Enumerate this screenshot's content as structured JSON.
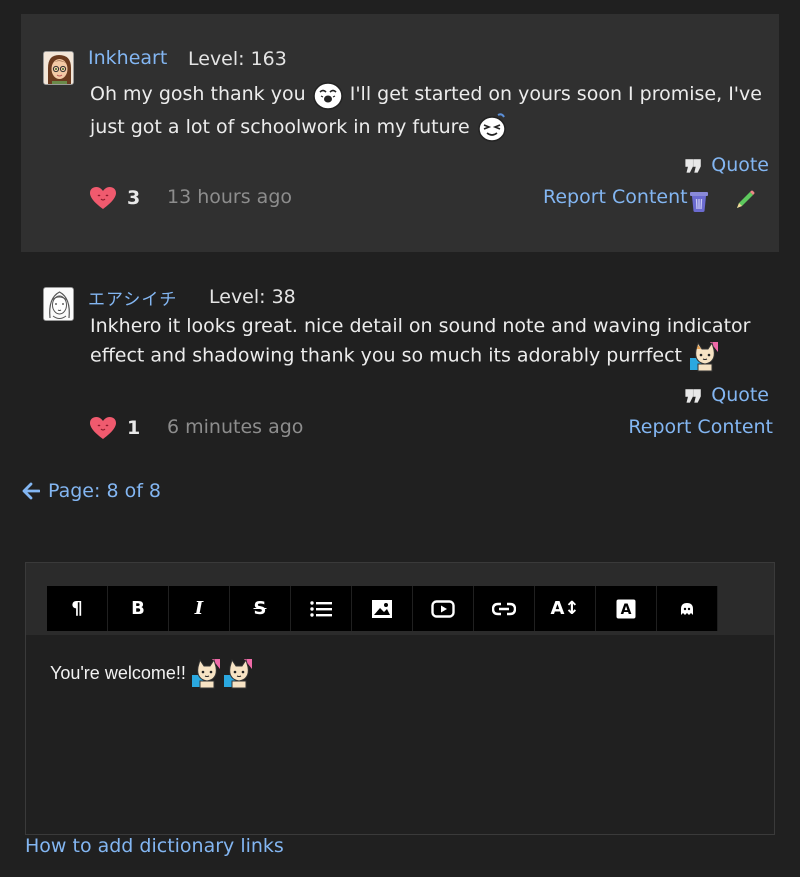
{
  "posts": [
    {
      "username": "Inkheart",
      "level": "Level: 163",
      "text_a": "Oh my gosh thank you",
      "text_b": "I'll get started on yours soon I promise, I've just got a lot of schoolwork in my future",
      "likes": "3",
      "time": "13 hours ago",
      "quote": "Quote",
      "report": "Report Content"
    },
    {
      "username": "エアシイチ",
      "level": "Level: 38",
      "text_a": "Inkhero it looks great. nice detail on sound note and waving indicator effect and shadowing thank you so much its adorably purrfect",
      "likes": "1",
      "time": "6 minutes ago",
      "quote": "Quote",
      "report": "Report Content"
    }
  ],
  "pager": {
    "label": "Page: 8 of 8"
  },
  "editor": {
    "toolbar": [
      "paragraph-icon",
      "bold-icon",
      "italic-icon",
      "strikethrough-icon",
      "list-icon",
      "image-icon",
      "video-icon",
      "link-icon",
      "font-size-icon",
      "font-color-icon",
      "emoji-icon"
    ],
    "content": "You're welcome!!"
  },
  "help_link": "How to add dictionary links",
  "colors": {
    "link": "#83b6f2",
    "heart": "#f05a6e",
    "bg": "#202020",
    "post_bg": "#303030"
  }
}
